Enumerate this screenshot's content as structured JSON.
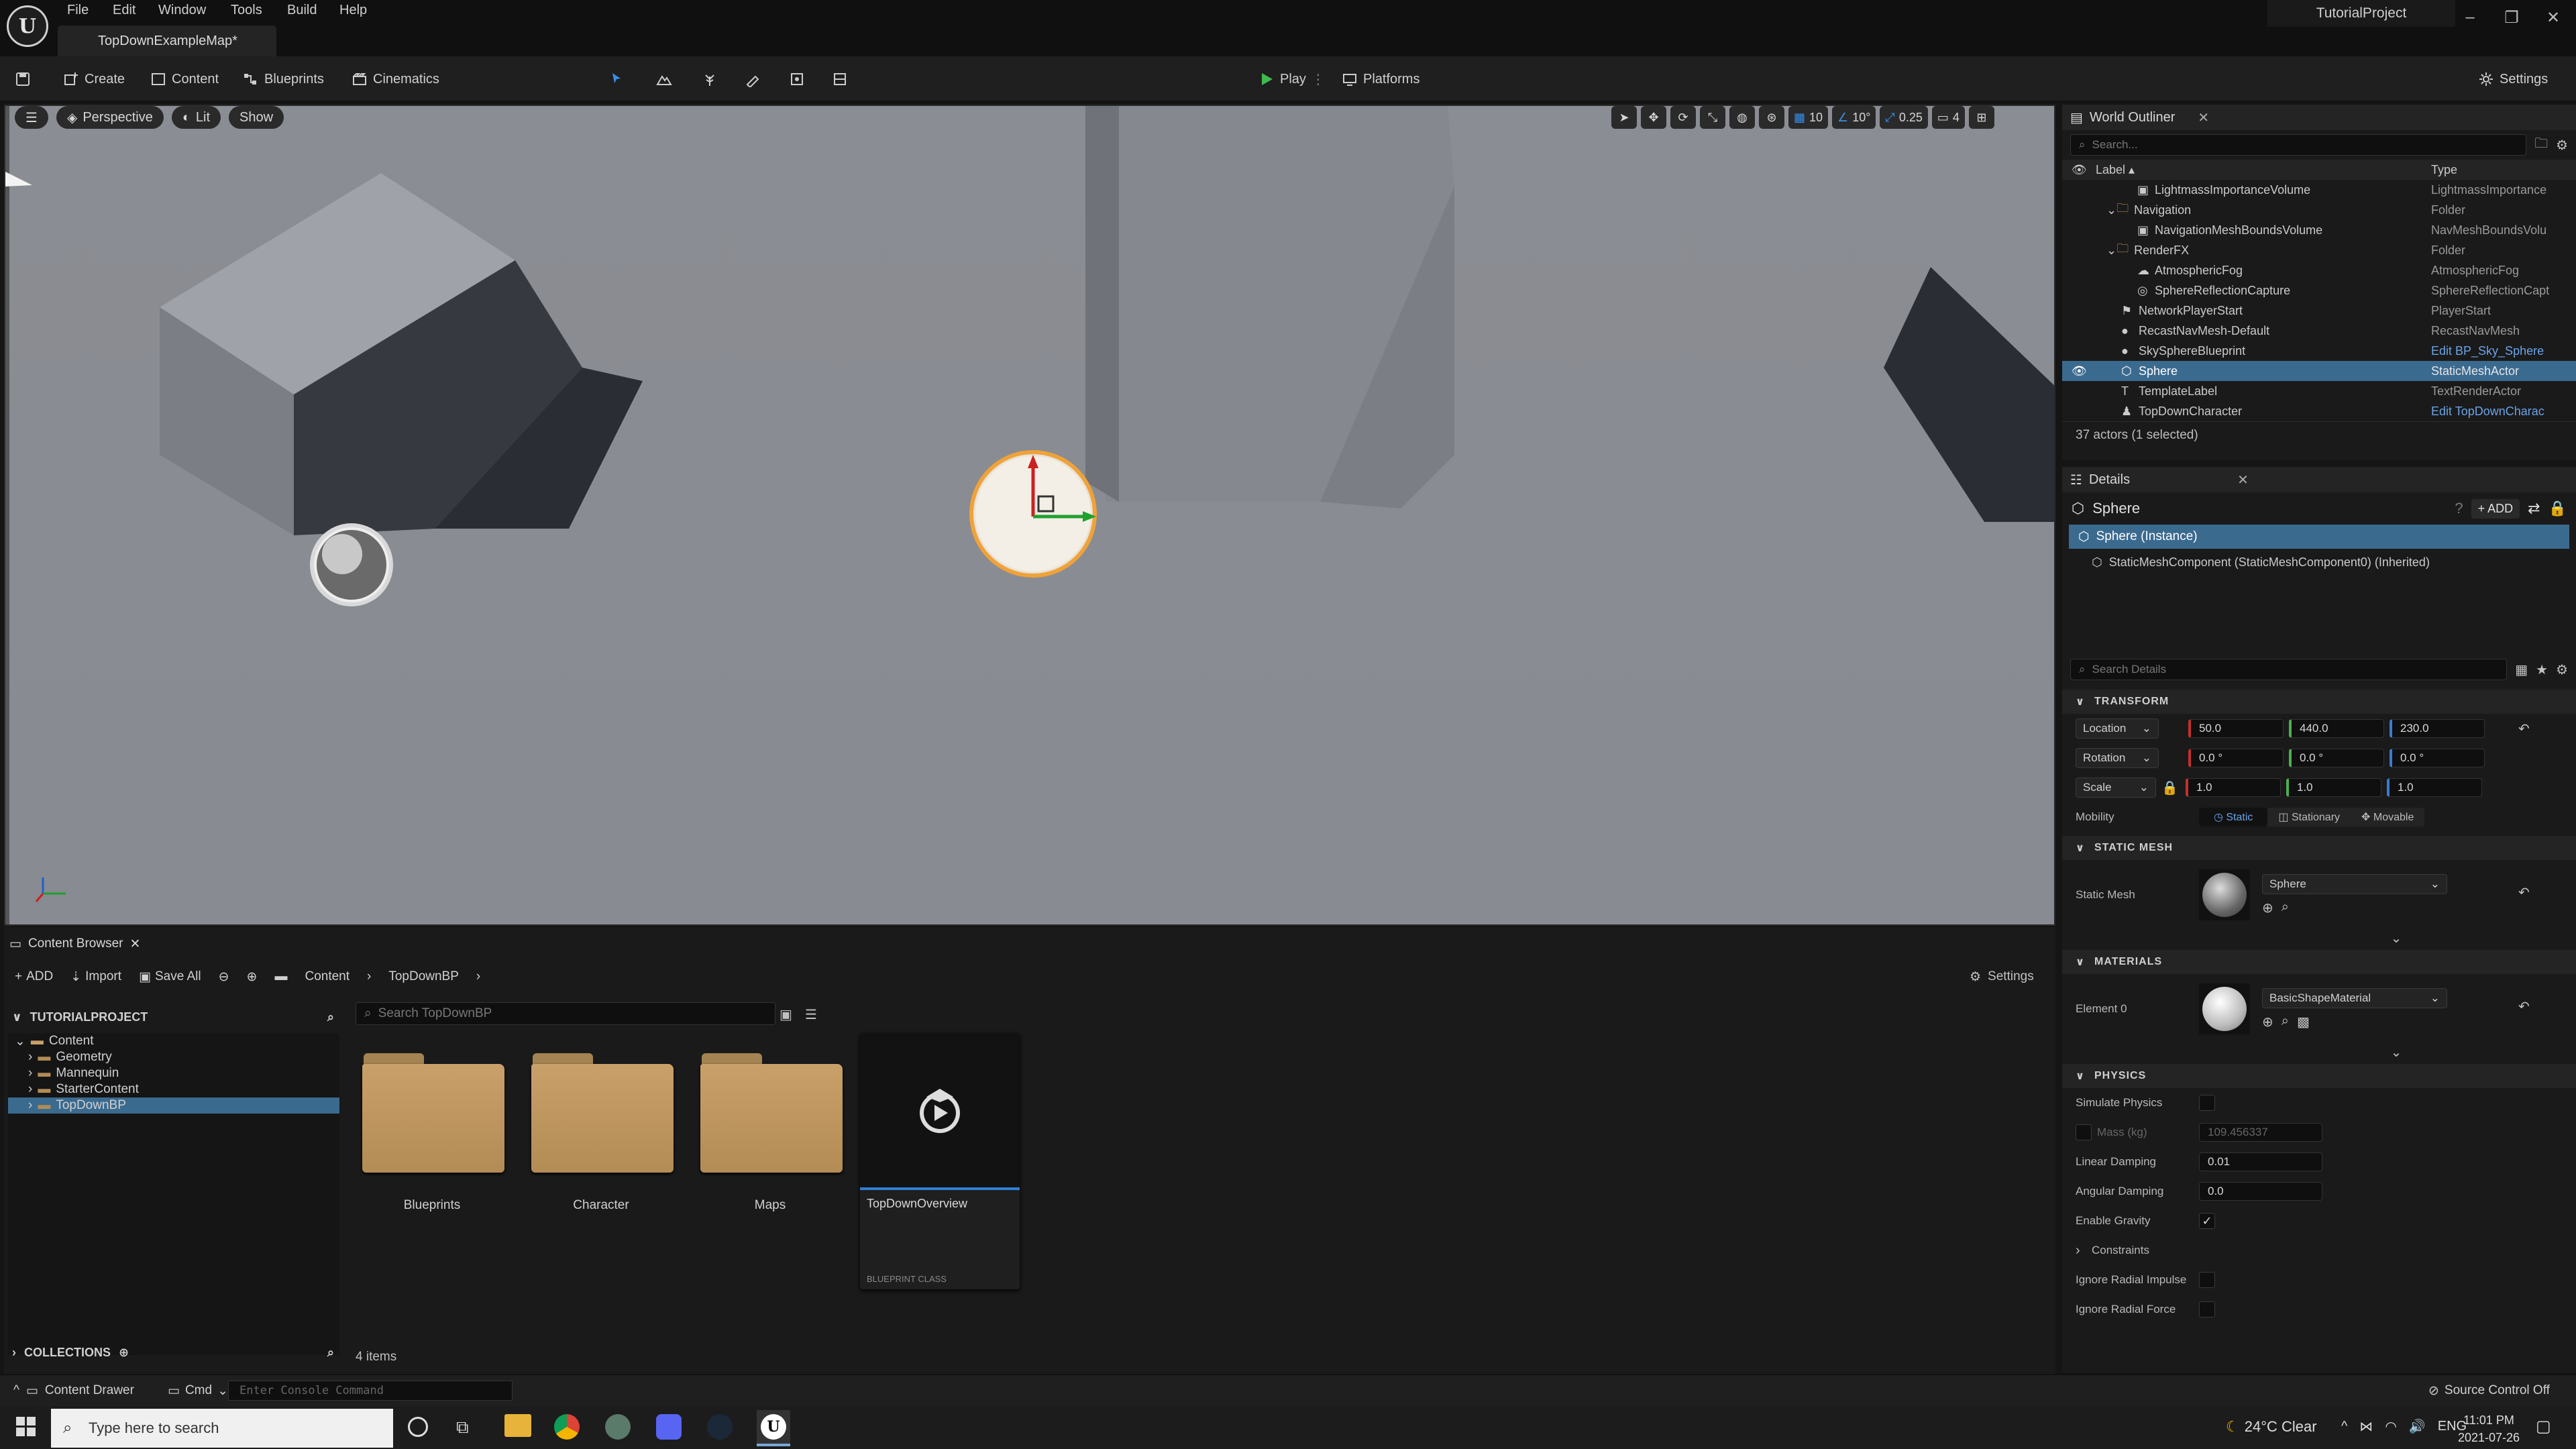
{
  "titlebar": {
    "menus": [
      "File",
      "Edit",
      "Window",
      "Tools",
      "Build",
      "Help"
    ],
    "doc_tab": "TopDownExampleMap*",
    "project_name": "TutorialProject"
  },
  "toolbar": {
    "create": "Create",
    "content": "Content",
    "blueprints": "Blueprints",
    "cinematics": "Cinematics",
    "play": "Play",
    "platforms": "Platforms",
    "settings": "Settings"
  },
  "viewport": {
    "perspective": "Perspective",
    "lit": "Lit",
    "show": "Show",
    "grid_snap": "10",
    "rot_snap": "10°",
    "scale_snap": "0.25",
    "cam_speed": "4"
  },
  "outliner": {
    "tab": "World Outliner",
    "search_placeholder": "Search...",
    "col_label": "Label",
    "col_type": "Type",
    "rows": [
      {
        "label": "LightmassImportanceVolume",
        "type": "LightmassImportance",
        "indent": 3,
        "icon": "volume-icon"
      },
      {
        "label": "Navigation",
        "type": "Folder",
        "indent": 2,
        "icon": "folder-icon"
      },
      {
        "label": "NavigationMeshBoundsVolume",
        "type": "NavMeshBoundsVolu",
        "indent": 3,
        "icon": "volume-icon"
      },
      {
        "label": "RenderFX",
        "type": "Folder",
        "indent": 2,
        "icon": "folder-icon"
      },
      {
        "label": "AtmosphericFog",
        "type": "AtmosphericFog",
        "indent": 3,
        "icon": "fog-icon"
      },
      {
        "label": "SphereReflectionCapture",
        "type": "SphereReflectionCapt",
        "indent": 3,
        "icon": "capture-icon"
      },
      {
        "label": "NetworkPlayerStart",
        "type": "PlayerStart",
        "indent": 2,
        "icon": "player-start-icon"
      },
      {
        "label": "RecastNavMesh-Default",
        "type": "RecastNavMesh",
        "indent": 2,
        "icon": "actor-icon"
      },
      {
        "label": "SkySphereBlueprint",
        "type": "Edit BP_Sky_Sphere",
        "indent": 2,
        "icon": "actor-icon",
        "link": true
      },
      {
        "label": "Sphere",
        "type": "StaticMeshActor",
        "indent": 2,
        "icon": "static-mesh-icon",
        "selected": true
      },
      {
        "label": "TemplateLabel",
        "type": "TextRenderActor",
        "indent": 2,
        "icon": "text-render-icon"
      },
      {
        "label": "TopDownCharacter",
        "type": "Edit TopDownCharac",
        "indent": 2,
        "icon": "character-icon",
        "link": true
      }
    ],
    "footer": "37 actors (1 selected)"
  },
  "details": {
    "tab": "Details",
    "actor_name": "Sphere",
    "add_label": "ADD",
    "instance": "Sphere (Instance)",
    "component": "StaticMeshComponent (StaticMeshComponent0) (Inherited)",
    "search_placeholder": "Search Details",
    "transform": {
      "header": "TRANSFORM",
      "location_label": "Location",
      "location": [
        "50.0",
        "440.0",
        "230.0"
      ],
      "rotation_label": "Rotation",
      "rotation": [
        "0.0 °",
        "0.0 °",
        "0.0 °"
      ],
      "scale_label": "Scale",
      "scale": [
        "1.0",
        "1.0",
        "1.0"
      ],
      "mobility_label": "Mobility",
      "mobility": [
        "Static",
        "Stationary",
        "Movable"
      ]
    },
    "static_mesh": {
      "header": "STATIC MESH",
      "label": "Static Mesh",
      "value": "Sphere"
    },
    "materials": {
      "header": "MATERIALS",
      "label": "Element 0",
      "value": "BasicShapeMaterial"
    },
    "physics": {
      "header": "PHYSICS",
      "simulate": "Simulate Physics",
      "mass_label": "Mass (kg)",
      "mass": "109.456337",
      "linear_label": "Linear Damping",
      "linear": "0.01",
      "angular_label": "Angular Damping",
      "angular": "0.0",
      "gravity": "Enable Gravity",
      "constraints": "Constraints",
      "radial_impulse": "Ignore Radial Impulse",
      "radial_force": "Ignore Radial Force"
    }
  },
  "content_browser": {
    "tab": "Content Browser",
    "add": "ADD",
    "import": "Import",
    "save_all": "Save All",
    "crumb_content": "Content",
    "crumb_folder": "TopDownBP",
    "settings": "Settings",
    "project_header": "TUTORIALPROJECT",
    "tree": [
      "Content",
      "Geometry",
      "Mannequin",
      "StarterContent",
      "TopDownBP"
    ],
    "search_placeholder": "Search TopDownBP",
    "folders": [
      "Blueprints",
      "Character",
      "Maps"
    ],
    "asset_name": "TopDownOverview",
    "asset_type": "BLUEPRINT CLASS",
    "count": "4 items",
    "collections": "COLLECTIONS"
  },
  "statusbar": {
    "drawer": "Content Drawer",
    "cmd": "Cmd",
    "console_placeholder": "Enter Console Command",
    "source_control": "Source Control Off"
  },
  "taskbar": {
    "search_placeholder": "Type here to search",
    "weather": "24°C  Clear",
    "lang": "ENG",
    "time": "11:01 PM",
    "date": "2021-07-26"
  },
  "colors": {
    "accent_blue": "#3b6a8f",
    "play_green": "#3fb950",
    "folder": "#c9a06a"
  }
}
